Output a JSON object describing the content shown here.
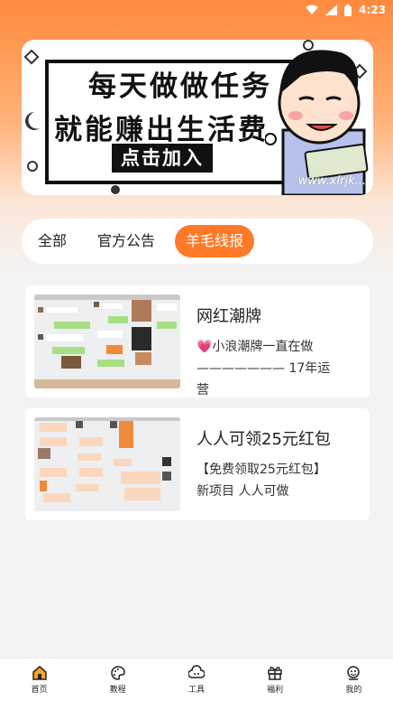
{
  "status": {
    "time": "4:23"
  },
  "banner": {
    "line1": "每天做做任务",
    "line2": "就能赚出生活费",
    "cta": "点击加入",
    "watermark": "www.xlrjk..."
  },
  "tabs": [
    {
      "label": "全部",
      "active": false
    },
    {
      "label": "官方公告",
      "active": false
    },
    {
      "label": "羊毛线报",
      "active": true
    }
  ],
  "posts": [
    {
      "title": "网红潮牌",
      "desc": "💗小浪潮牌一直在做——————— 17年运营"
    },
    {
      "title": "人人可领25元红包",
      "desc": "【免费领取25元红包】 新项目 人人可做"
    }
  ],
  "nav": [
    {
      "label": "首页",
      "icon": "home-icon",
      "active": true
    },
    {
      "label": "教程",
      "icon": "palette-icon",
      "active": false
    },
    {
      "label": "工具",
      "icon": "cloud-face-icon",
      "active": false
    },
    {
      "label": "福利",
      "icon": "gift-icon",
      "active": false
    },
    {
      "label": "我的",
      "icon": "user-face-icon",
      "active": false
    }
  ],
  "colors": {
    "accent": "#ff7a28",
    "gradient_top": "#ff8a3c"
  }
}
